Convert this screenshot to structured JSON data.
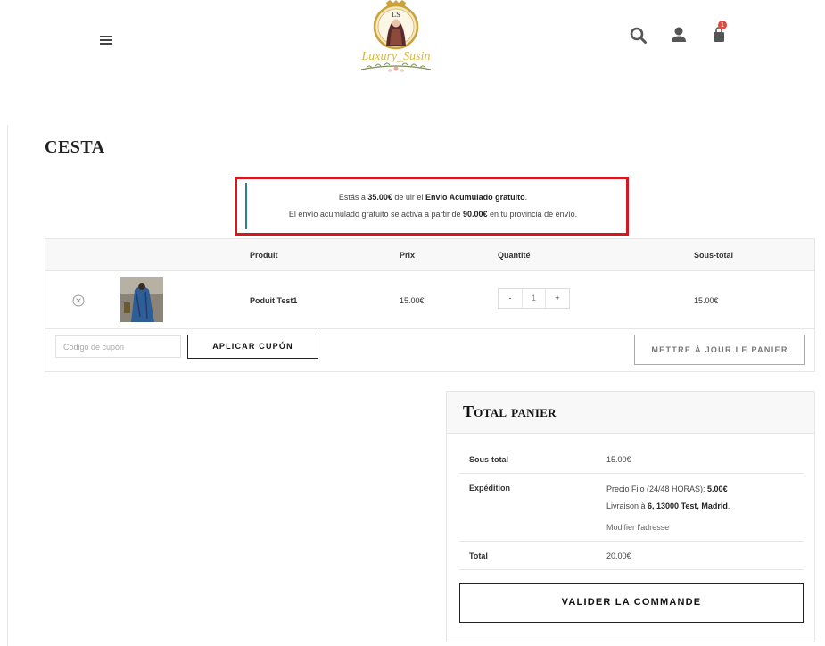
{
  "header": {
    "menu_icon": "hamburger-menu-icon",
    "logo": {
      "monogram": "LS",
      "script_text": "Luxury_Susin"
    },
    "icons": [
      "search-icon",
      "user-icon",
      "cart-bag-icon"
    ],
    "cart_count": "1",
    "badge_color": "#e0493d"
  },
  "page": {
    "title": "CESTA"
  },
  "notice": {
    "line1_pre": "Estás a ",
    "line1_amount": "35.00€",
    "line1_mid": " de uir el ",
    "line1_bold": "Envio Acumulado gratuito",
    "line1_post": ".",
    "line2_pre": "El envío acumulado gratuito se activa a partir de ",
    "line2_amount": "90.00€",
    "line2_post": " en tu provincia de envío.",
    "highlight_color": "#d7171f",
    "accent_color": "#2a7e9a"
  },
  "cart": {
    "columns": {
      "product": "Produit",
      "price": "Prix",
      "quantity": "Quantité",
      "subtotal": "Sous-total"
    },
    "items": [
      {
        "name": "Poduit Test1",
        "price": "15.00€",
        "quantity": "1",
        "subtotal": "15.00€"
      }
    ],
    "qty_minus": "-",
    "qty_plus": "+",
    "coupon_placeholder": "Código de cupón",
    "apply_coupon": "APLICAR CUPÓN",
    "update_cart": "METTRE À JOUR LE PANIER"
  },
  "totals": {
    "title": "Total panier",
    "subtotal_label": "Sous-total",
    "subtotal_value": "15.00€",
    "shipping_label": "Expédition",
    "shipping_method": "Precio Fijo (24/48 HORAS): ",
    "shipping_price": "5.00€",
    "delivery_pre": "Livraison à ",
    "delivery_address": "6, 13000 Test, Madrid",
    "delivery_post": ".",
    "modify_address": "Modifier l'adresse",
    "total_label": "Total",
    "total_value": "20.00€",
    "checkout": "VALIDER LA COMMANDE"
  }
}
